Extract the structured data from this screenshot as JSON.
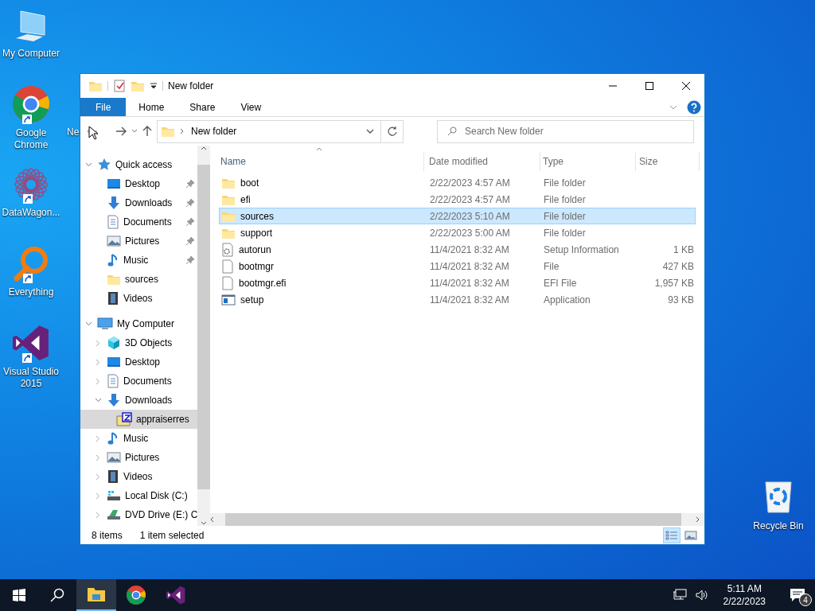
{
  "desktop": {
    "icons": [
      {
        "label": "My Computer",
        "kind": "computer",
        "shortcut": false
      },
      {
        "label": "Google Chrome",
        "kind": "chrome",
        "shortcut": true
      },
      {
        "label": "DataWagon...",
        "kind": "datawagon",
        "shortcut": true
      },
      {
        "label": "Everything",
        "kind": "everything",
        "shortcut": true
      },
      {
        "label": "Visual Studio 2015",
        "kind": "vs",
        "shortcut": true
      }
    ],
    "covered_label": "Ne",
    "recycle_bin": {
      "label": "Recycle Bin"
    }
  },
  "window": {
    "title": "New folder",
    "ribbon_tabs": [
      {
        "label": "File",
        "kind": "file"
      },
      {
        "label": "Home",
        "kind": "tab"
      },
      {
        "label": "Share",
        "kind": "tab"
      },
      {
        "label": "View",
        "kind": "tab"
      }
    ],
    "nav": {
      "back_disabled": true
    },
    "address": {
      "path": "New folder"
    },
    "search": {
      "placeholder": "Search New folder"
    },
    "tree": [
      {
        "label": "Quick access",
        "kind": "star",
        "expanded": true,
        "selected": false,
        "children": [
          {
            "label": "Desktop",
            "kind": "desktop",
            "pinned": true,
            "selected": false
          },
          {
            "label": "Downloads",
            "kind": "downloads",
            "pinned": true,
            "selected": false
          },
          {
            "label": "Documents",
            "kind": "documents",
            "pinned": true,
            "selected": false
          },
          {
            "label": "Pictures",
            "kind": "pictures",
            "pinned": true,
            "selected": false
          },
          {
            "label": "Music",
            "kind": "music",
            "pinned": true,
            "selected": false
          },
          {
            "label": "sources",
            "kind": "folder",
            "pinned": false,
            "selected": false
          },
          {
            "label": "Videos",
            "kind": "videos",
            "pinned": false,
            "selected": false
          }
        ]
      },
      {
        "label": "My Computer",
        "kind": "computer",
        "expanded": true,
        "selected": false,
        "children": [
          {
            "label": "3D Objects",
            "kind": "objects3d",
            "expanded": false,
            "selected": false
          },
          {
            "label": "Desktop",
            "kind": "desktop",
            "expanded": false,
            "selected": false
          },
          {
            "label": "Documents",
            "kind": "documents",
            "expanded": false,
            "selected": false
          },
          {
            "label": "Downloads",
            "kind": "downloads",
            "expanded": true,
            "selected": false,
            "children": [
              {
                "label": "appraiserres",
                "kind": "zipfolder",
                "selected": true
              }
            ]
          },
          {
            "label": "Music",
            "kind": "music",
            "expanded": false,
            "selected": false
          },
          {
            "label": "Pictures",
            "kind": "pictures",
            "expanded": false,
            "selected": false
          },
          {
            "label": "Videos",
            "kind": "videos",
            "expanded": false,
            "selected": false
          },
          {
            "label": "Local Disk (C:)",
            "kind": "disk",
            "expanded": false,
            "selected": false
          },
          {
            "label": "DVD Drive (E:) C",
            "kind": "dvd",
            "expanded": false,
            "selected": false
          }
        ]
      }
    ],
    "columns": [
      "Name",
      "Date modified",
      "Type",
      "Size"
    ],
    "files": [
      {
        "name": "boot",
        "date": "2/22/2023 4:57 AM",
        "type": "File folder",
        "kind": "folder",
        "selected": false
      },
      {
        "name": "efi",
        "date": "2/22/2023 4:57 AM",
        "type": "File folder",
        "kind": "folder",
        "selected": false
      },
      {
        "name": "sources",
        "date": "2/22/2023 5:10 AM",
        "type": "File folder",
        "kind": "folder",
        "selected": true
      },
      {
        "name": "support",
        "date": "2/22/2023 5:00 AM",
        "type": "File folder",
        "kind": "folder",
        "selected": false
      },
      {
        "name": "autorun",
        "date": "11/4/2021 8:32 AM",
        "type": "Setup Information",
        "size": "1 KB",
        "kind": "settingsfile",
        "selected": false
      },
      {
        "name": "bootmgr",
        "date": "11/4/2021 8:32 AM",
        "type": "File",
        "size": "427 KB",
        "kind": "file",
        "selected": false
      },
      {
        "name": "bootmgr.efi",
        "date": "11/4/2021 8:32 AM",
        "type": "EFI File",
        "size": "1,957 KB",
        "kind": "file",
        "selected": false
      },
      {
        "name": "setup",
        "date": "11/4/2021 8:32 AM",
        "type": "Application",
        "size": "93 KB",
        "kind": "app",
        "selected": false
      }
    ],
    "status": {
      "count": "8 items",
      "selection": "1 item selected"
    },
    "views": [
      {
        "kind": "details",
        "selected": true
      },
      {
        "kind": "thumbs",
        "selected": false
      }
    ]
  },
  "taskbar": {
    "apps": [
      {
        "kind": "explorer",
        "active": true
      },
      {
        "kind": "chrome",
        "active": false
      },
      {
        "kind": "vs",
        "active": false
      }
    ],
    "time": "5:11 AM",
    "date": "2/22/2023",
    "notifications": "4"
  }
}
